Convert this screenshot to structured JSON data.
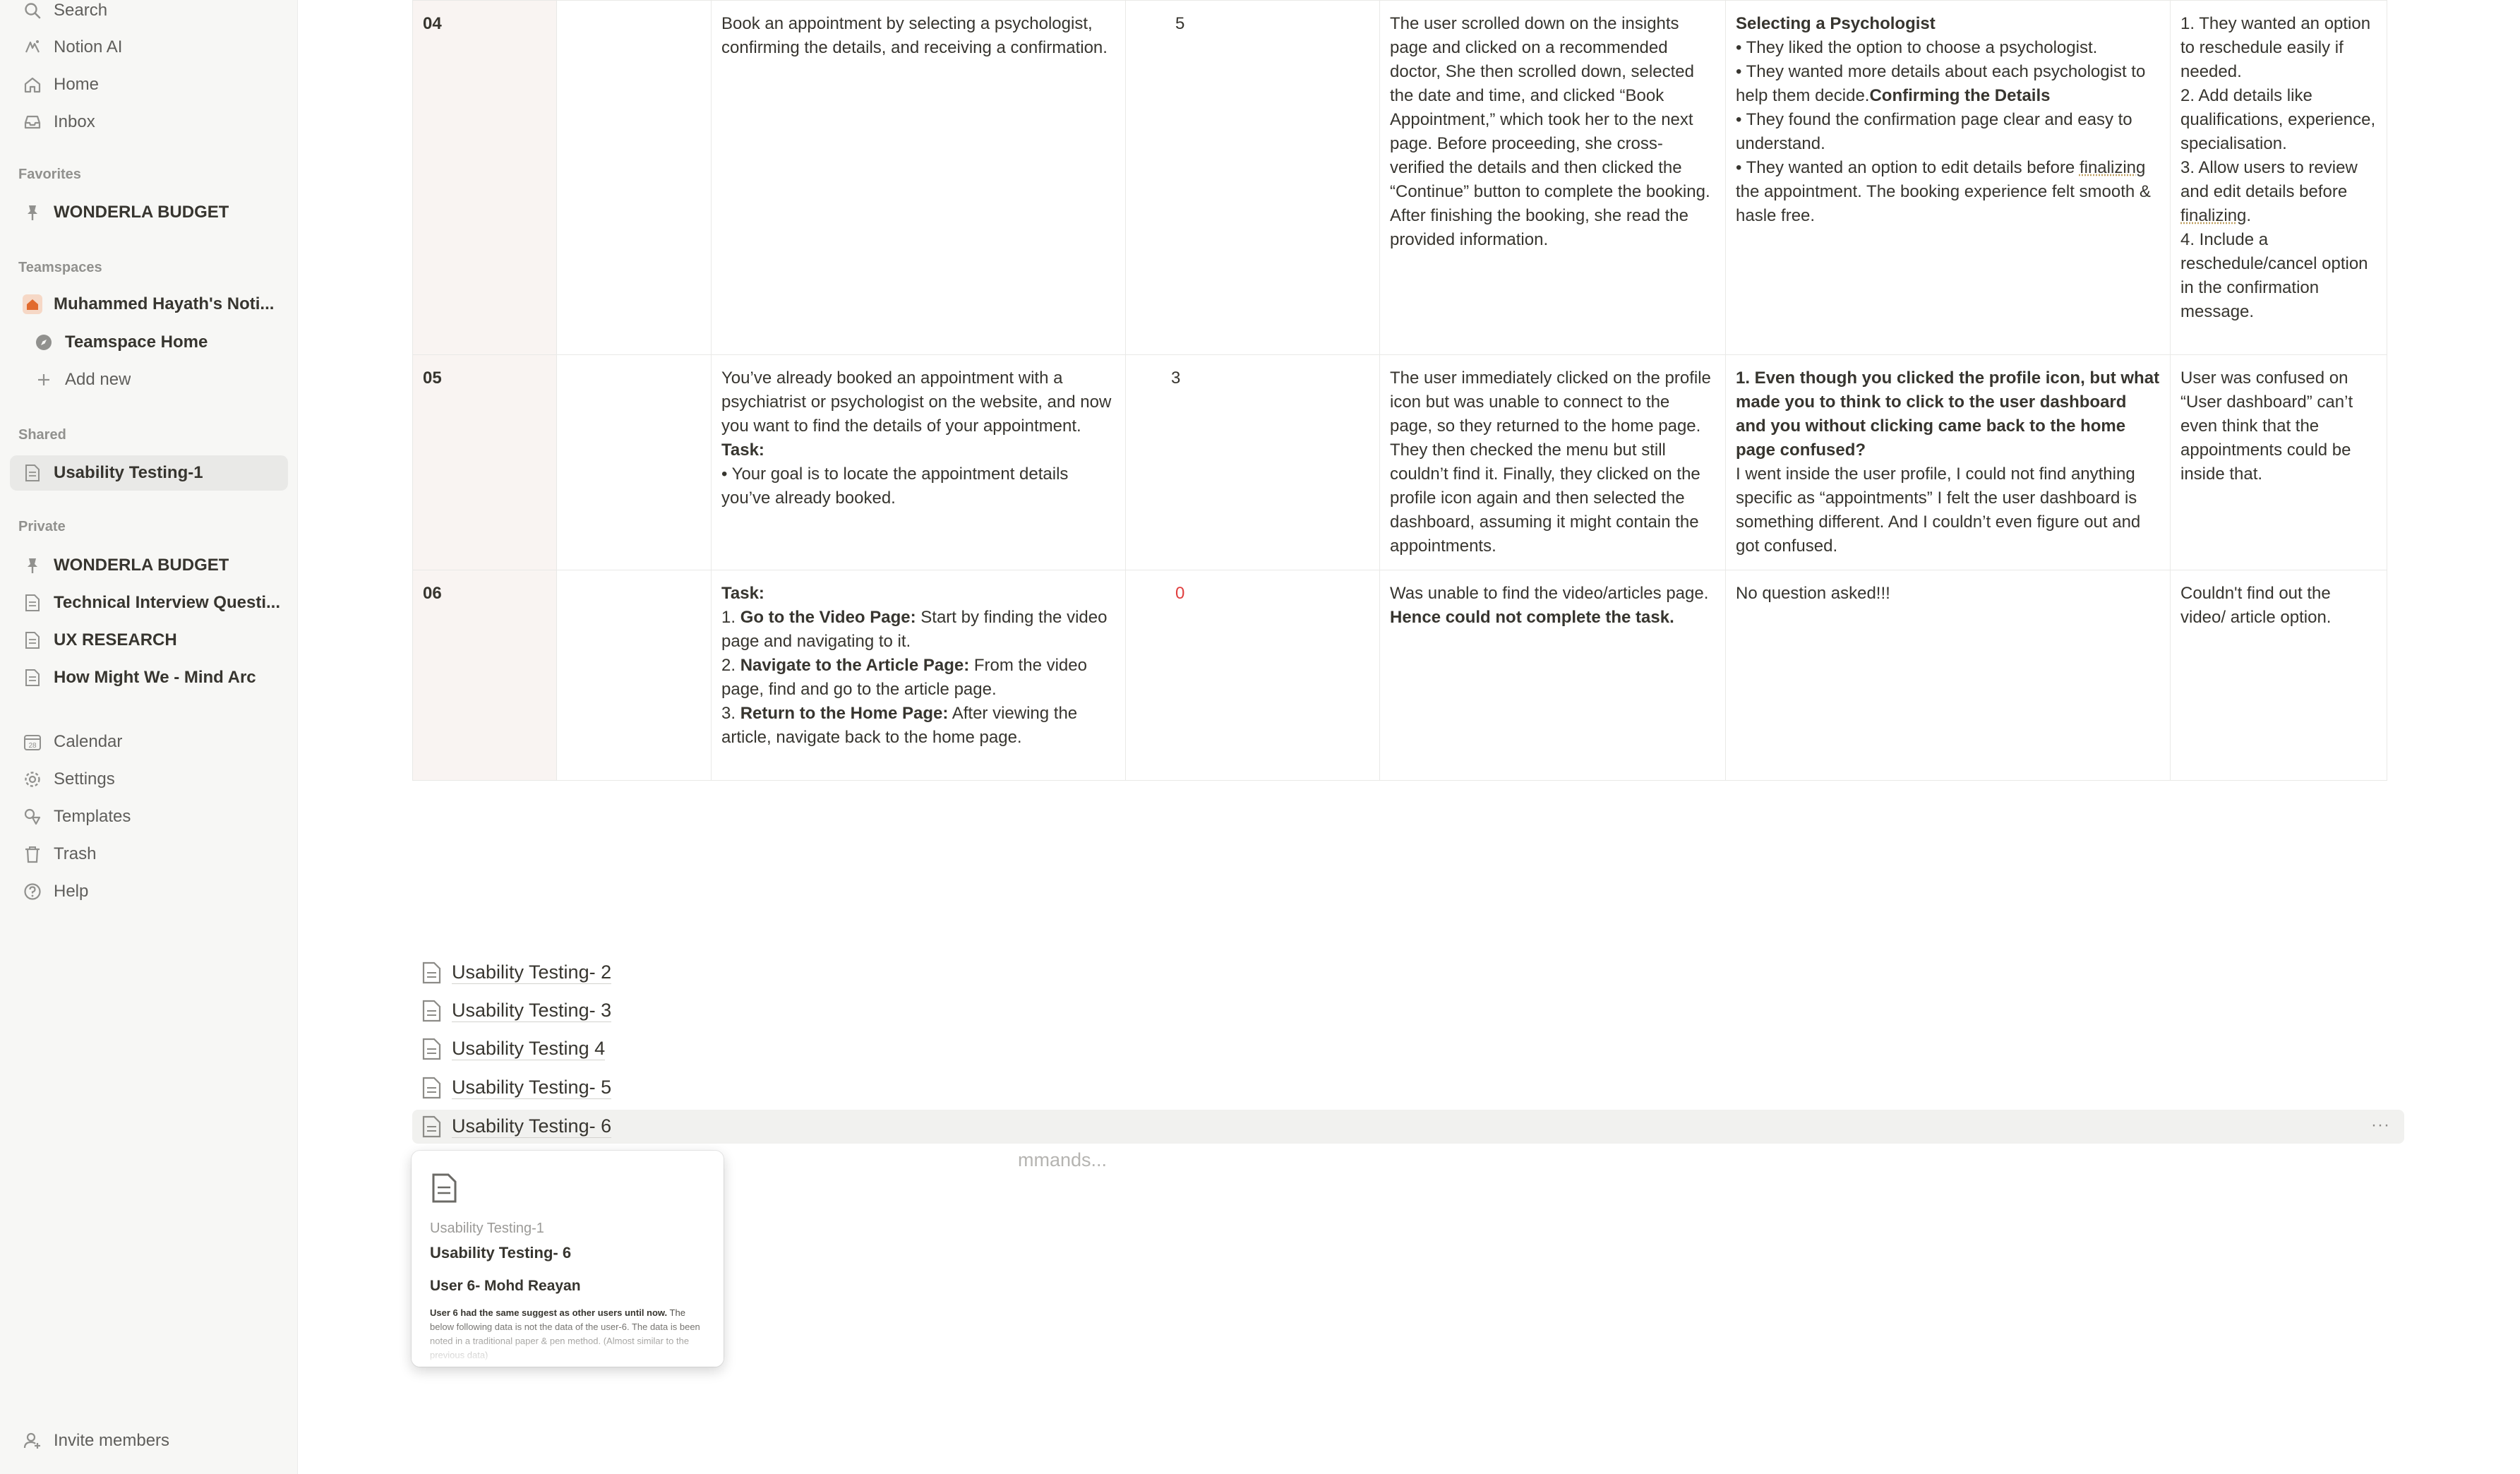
{
  "sidebar": {
    "top": [
      {
        "label": "Search",
        "icon": "search-icon"
      },
      {
        "label": "Notion AI",
        "icon": "notion-ai-icon"
      },
      {
        "label": "Home",
        "icon": "home-icon"
      },
      {
        "label": "Inbox",
        "icon": "inbox-icon"
      }
    ],
    "favorites_label": "Favorites",
    "favorites": [
      {
        "label": "WONDERLA BUDGET",
        "icon": "pin-icon"
      }
    ],
    "teamspaces_label": "Teamspaces",
    "teamspaces": [
      {
        "label": "Muhammed Hayath's Noti...",
        "icon": "house-icon"
      },
      {
        "label": "Teamspace Home",
        "icon": "compass-icon"
      },
      {
        "label": "Add new",
        "icon": "plus-icon"
      }
    ],
    "shared_label": "Shared",
    "shared": [
      {
        "label": "Usability Testing-1",
        "icon": "page-icon"
      }
    ],
    "private_label": "Private",
    "private": [
      {
        "label": "WONDERLA BUDGET",
        "icon": "pin-icon"
      },
      {
        "label": "Technical Interview Questi...",
        "icon": "page-icon"
      },
      {
        "label": "UX RESEARCH",
        "icon": "page-icon"
      },
      {
        "label": "How Might We - Mind Arc",
        "icon": "page-icon"
      }
    ],
    "bottom": [
      {
        "label": "Calendar",
        "icon": "calendar-icon"
      },
      {
        "label": "Settings",
        "icon": "gear-icon"
      },
      {
        "label": "Templates",
        "icon": "templates-icon"
      },
      {
        "label": "Trash",
        "icon": "trash-icon"
      },
      {
        "label": "Help",
        "icon": "help-icon"
      }
    ],
    "invite": {
      "label": "Invite members",
      "icon": "invite-icon"
    }
  },
  "table": {
    "rows": [
      {
        "num": "04",
        "task": "Book an appointment by selecting a psychologist, confirming the details, and receiving a confirmation.",
        "score": "5",
        "observation": "The user scrolled down on the insights page and clicked on a recommended doctor, She then scrolled down, selected the date and time, and clicked “Book Appointment,” which took her to the next page. Before proceeding, she cross-verified the details and then clicked the “Continue” button to complete the booking. After finishing the booking, she read the provided information.",
        "feedback": {
          "h1": "Selecting a Psychologist",
          "l1": "• They liked the option to choose a psychologist.",
          "l2": "• They wanted more details about each psychologist to help them decide.",
          "h2": "Confirming the Details",
          "l3": "• They found the confirmation page clear and easy to understand.",
          "l4a": "• They wanted an option to edit details before ",
          "l4b": "finalizing",
          "l4c": " the appointment. The booking experience felt smooth & hasle free."
        },
        "insight": {
          "i1": "1. They wanted an option to reschedule easily if needed.",
          "i2": "2. Add details like qualifications, experience, specialisation.",
          "i3a": "3. Allow users to review and edit details before ",
          "i3b": "finalizing",
          "i3c": ".",
          "i4": "4. Include a reschedule/cancel option in the confirmation message."
        }
      },
      {
        "num": "05",
        "task_p": "You’ve already booked an appointment with a psychiatrist or psychologist on the website, and now you want to find the details of your appointment.",
        "task_h": "Task:",
        "task_b": "• Your goal is to locate the appointment details you’ve already booked.",
        "score": "3",
        "observation": "The user immediately clicked on the profile icon but was unable to connect to the page, so they returned to the home page. They then checked the menu but still couldn’t find it. Finally, they clicked on the profile icon again and then selected the dashboard, assuming it might contain the appointments.",
        "feedback_q": "1. Even though you clicked the profile icon, but what made you to think to click to the user dashboard and you without clicking came back to the home page confused?",
        "feedback_a": "I went inside the user profile, I could not find anything specific as “appointments” I felt the user dashboard is something different. And I couldn’t even figure out and got confused.",
        "insight": "User was confused on “User dashboard” can’t even think that the appointments could be inside that."
      },
      {
        "num": "06",
        "task_h": "Task:",
        "s1n": "1. ",
        "s1b": "Go to the Video Page:",
        "s1t": " Start by finding the video page and navigating to it.",
        "s2n": "2. ",
        "s2b": "Navigate to the Article Page:",
        "s2t": " From the video page, find and go to the article page.",
        "s3n": "3. ",
        "s3b": "Return to the Home Page:",
        "s3t": " After viewing the article, navigate back to the home page.",
        "score": "0",
        "obs_a": "Was unable to find the video/articles page. ",
        "obs_b": "Hence could not complete the task.",
        "feedback": "No question asked!!!",
        "insight": "Couldn't find out the video/ article option."
      }
    ]
  },
  "pages": [
    {
      "label": "Usability Testing- 2"
    },
    {
      "label": "Usability Testing- 3"
    },
    {
      "label": "Usability Testing 4"
    },
    {
      "label": "Usability Testing- 5"
    },
    {
      "label": "Usability Testing- 6"
    }
  ],
  "placeholder": "mmands...",
  "more_label": "···",
  "preview": {
    "parent": "Usability Testing-1",
    "title": "Usability Testing- 6",
    "heading": "User 6-  Mohd Reayan",
    "body_bold": "User 6 had the same suggest as other users until now.",
    "body": " The below following data is not the data of the user-6. The data is been noted in a traditional paper & pen method. (Almost similar to the previous data)"
  }
}
